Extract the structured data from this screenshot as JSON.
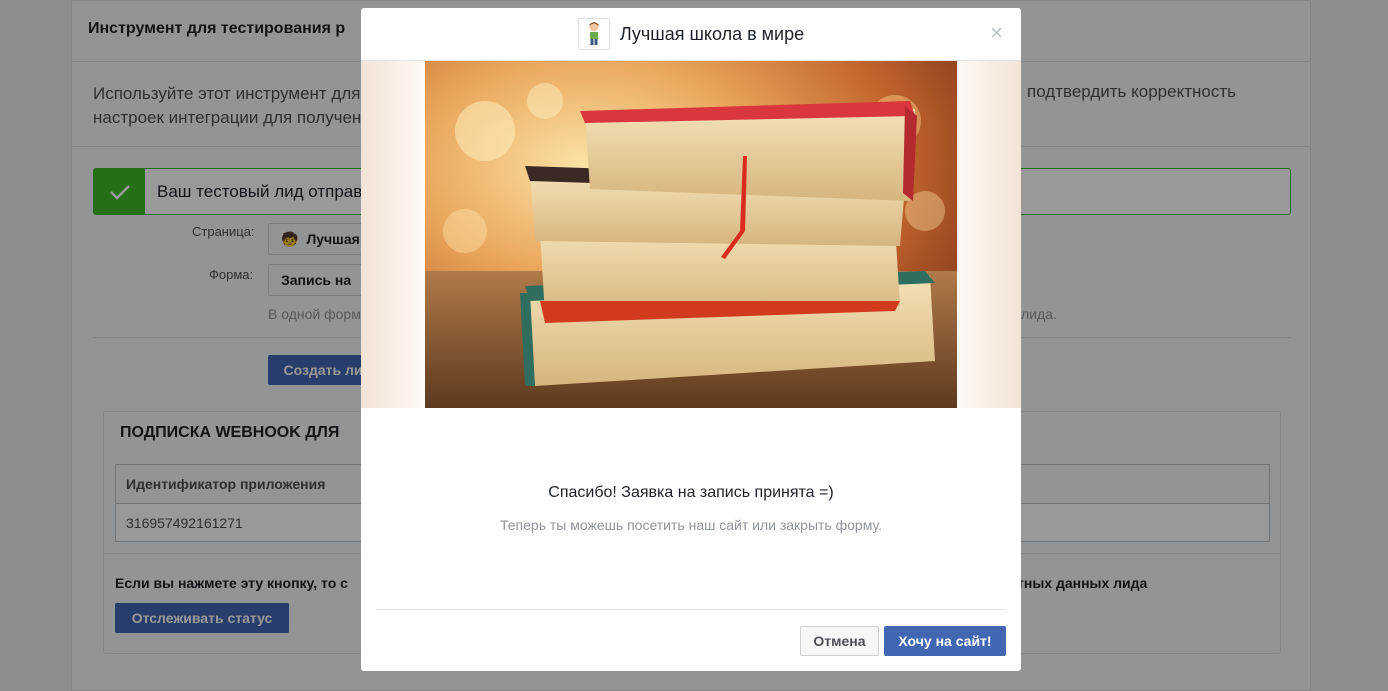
{
  "background": {
    "header_title": "Инструмент для тестирования р",
    "intro_left_1": "Используйте этот инструмент для",
    "intro_left_2": "настроек интеграции для получен",
    "intro_right": "подтвердить корректность",
    "success_text": "Ваш тестовый лид отправ",
    "page_label": "Страница:",
    "page_value": "Лучшая",
    "form_label": "Форма:",
    "form_value": "Запись на",
    "hint_left": "В одной форм",
    "hint_right": "лида.",
    "create_button": "Создать ли",
    "webhook_title": "ПОДПИСКА WEBHOOK ДЛЯ",
    "table_header": "Идентификатор приложения",
    "table_value": "316957492161271",
    "note_left": "Если вы нажмете эту кнопку, то с",
    "note_right": "тных данных лида",
    "track_button": "Отслеживать статус"
  },
  "modal": {
    "title": "Лучшая школа в мире",
    "close_symbol": "×",
    "message_title": "Спасибо! Заявка на запись принята =)",
    "message_subtitle": "Теперь ты можешь посетить наш сайт или закрыть форму.",
    "cancel_label": "Отмена",
    "go_label": "Хочу на сайт!"
  },
  "colors": {
    "primary": "#4267b2",
    "success": "#42b72a",
    "overlay": "rgba(0,0,0,0.4)"
  }
}
